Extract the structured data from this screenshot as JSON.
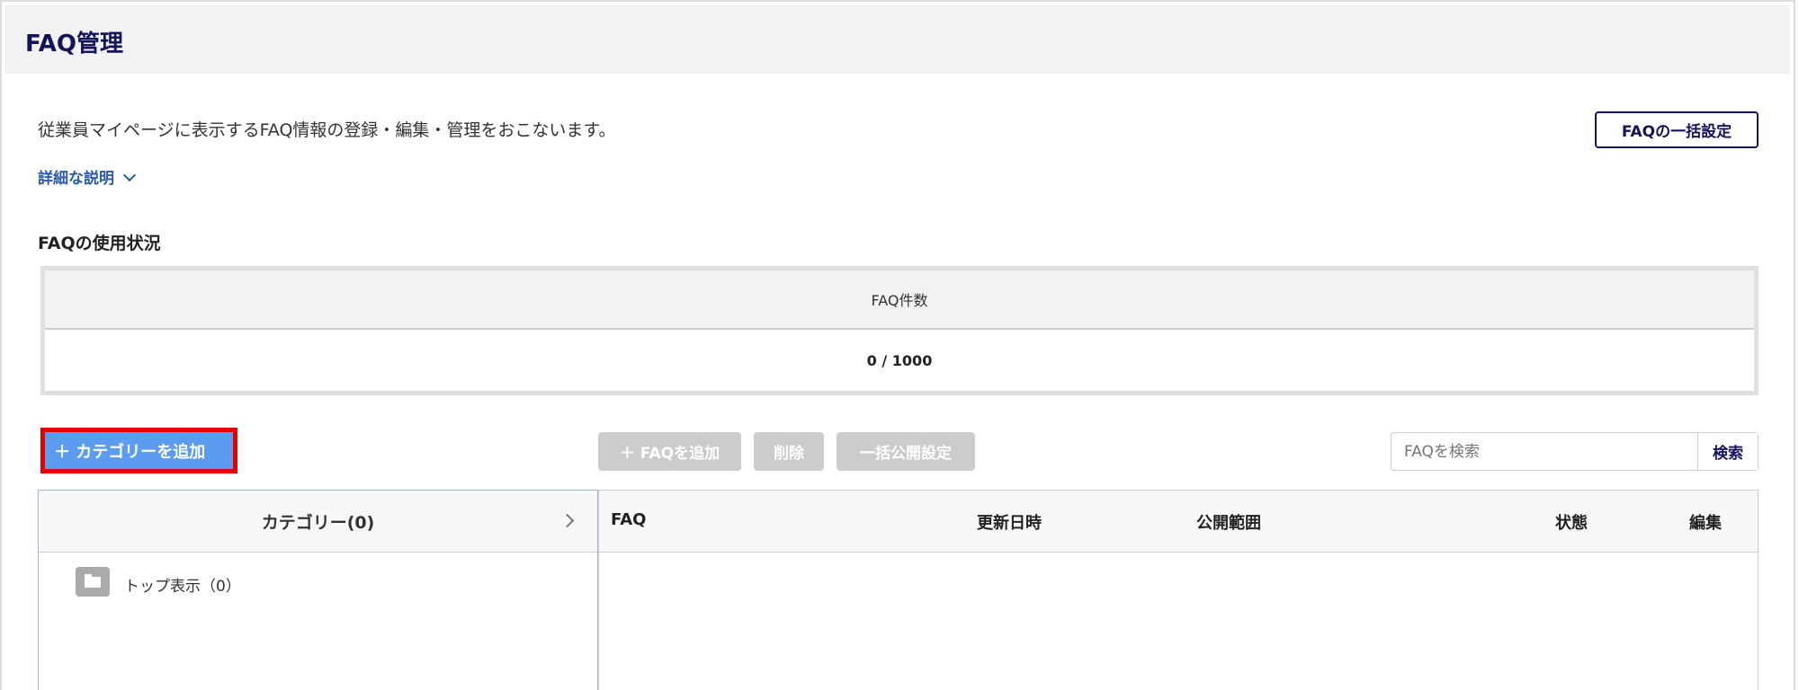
{
  "header": {
    "title": "FAQ管理"
  },
  "intro": {
    "description": "従業員マイページに表示するFAQ情報の登録・編集・管理をおこないます。",
    "details_link": "詳細な説明",
    "bulk_button": "FAQの一括設定"
  },
  "usage": {
    "title": "FAQの使用状況",
    "column": "FAQ件数",
    "value": "0 / 1000"
  },
  "toolbar": {
    "add_category": "＋ カテゴリーを追加",
    "add_faq": "＋ FAQを追加",
    "delete": "削除",
    "bulk_publish": "一括公開設定",
    "search_placeholder": "FAQを検索",
    "search_button": "検索"
  },
  "categories": {
    "header": "カテゴリー(0)",
    "items": [
      {
        "label": "トップ表示（0）"
      }
    ]
  },
  "faq_table": {
    "columns": [
      "FAQ",
      "更新日時",
      "公開範囲",
      "状態",
      "編集"
    ]
  }
}
